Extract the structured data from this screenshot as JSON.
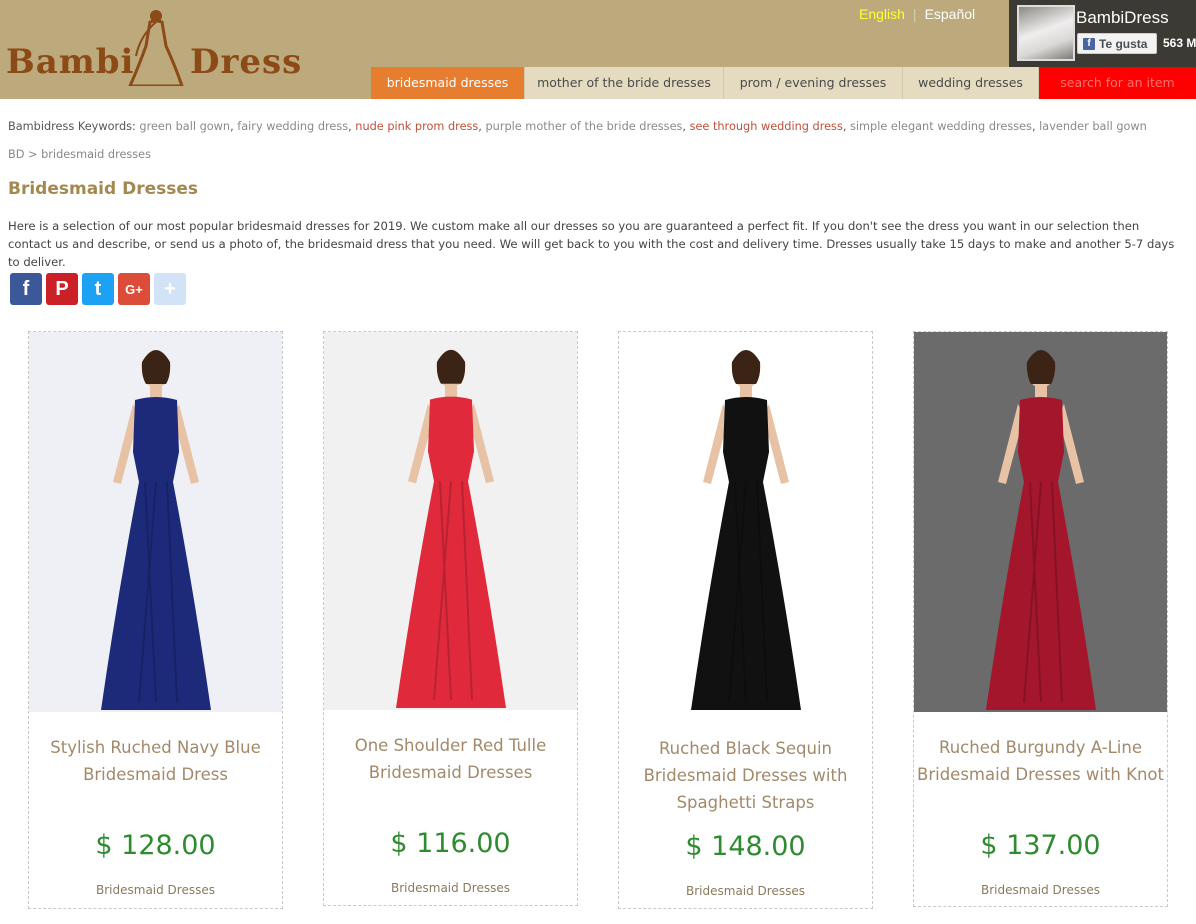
{
  "header": {
    "logo": {
      "word1": "Bambi",
      "word2": "Dress"
    },
    "languages": {
      "english": "English",
      "separator": "|",
      "spanish": "Español"
    },
    "facebook": {
      "page_name": "BambiDress",
      "like_label": "Te gusta",
      "like_count": "563 M"
    },
    "nav": [
      {
        "label": "bridesmaid dresses",
        "active": true
      },
      {
        "label": "mother of the bride dresses"
      },
      {
        "label": "prom / evening dresses"
      },
      {
        "label": "wedding dresses"
      },
      {
        "label": "search for an item"
      }
    ]
  },
  "keywords": {
    "prefix": "Bambidress Keywords: ",
    "items": [
      {
        "text": "green ball gown",
        "hot": false
      },
      {
        "text": "fairy wedding dress",
        "hot": false
      },
      {
        "text": "nude pink prom dress",
        "hot": true
      },
      {
        "text": "purple mother of the bride dresses",
        "hot": false
      },
      {
        "text": "see through wedding dress",
        "hot": true
      },
      {
        "text": "simple elegant wedding dresses",
        "hot": false
      },
      {
        "text": "lavender ball gown",
        "hot": false
      }
    ]
  },
  "breadcrumb": {
    "home": "BD",
    "separator": " > ",
    "current": "bridesmaid dresses"
  },
  "page": {
    "title": "Bridesmaid Dresses",
    "intro": "Here is a selection of our most popular bridesmaid dresses for 2019. We custom make all our dresses so you are guaranteed a perfect fit. If you don't see the dress you want in our selection then contact us and describe, or send us a photo of, the bridesmaid dress that you need. We will get back to you with the cost and delivery time. Dresses usually take 15 days to make and another 5-7 days to deliver."
  },
  "share": [
    {
      "icon": "facebook-icon",
      "glyph": "f",
      "color": "#3b5998"
    },
    {
      "icon": "pinterest-icon",
      "glyph": "P",
      "color": "#cb2027"
    },
    {
      "icon": "twitter-icon",
      "glyph": "t",
      "color": "#1da1f2"
    },
    {
      "icon": "google-plus-icon",
      "glyph": "G+",
      "color": "#dd4b39"
    },
    {
      "icon": "add-more-icon",
      "glyph": "+",
      "color": "#d3e3f7"
    }
  ],
  "products": [
    {
      "name": "Stylish Ruched Navy Blue Bridesmaid Dress",
      "price": "$ 128.00",
      "category": "Bridesmaid Dresses",
      "dress_color": "#1d2a7a",
      "bg_color": "#eef0f6"
    },
    {
      "name": "One Shoulder Red Tulle Bridesmaid Dresses",
      "price": "$ 116.00",
      "category": "Bridesmaid Dresses",
      "dress_color": "#e02a3c",
      "bg_color": "#f1f1f1"
    },
    {
      "name": "Ruched Black Sequin Bridesmaid Dresses with Spaghetti Straps",
      "price": "$ 148.00",
      "category": "Bridesmaid Dresses",
      "dress_color": "#111111",
      "bg_color": "#ffffff"
    },
    {
      "name": "Ruched Burgundy A-Line Bridesmaid Dresses with Knot",
      "price": "$ 137.00",
      "category": "Bridesmaid Dresses",
      "dress_color": "#a3162c",
      "bg_color": "#6b6b6b"
    }
  ]
}
